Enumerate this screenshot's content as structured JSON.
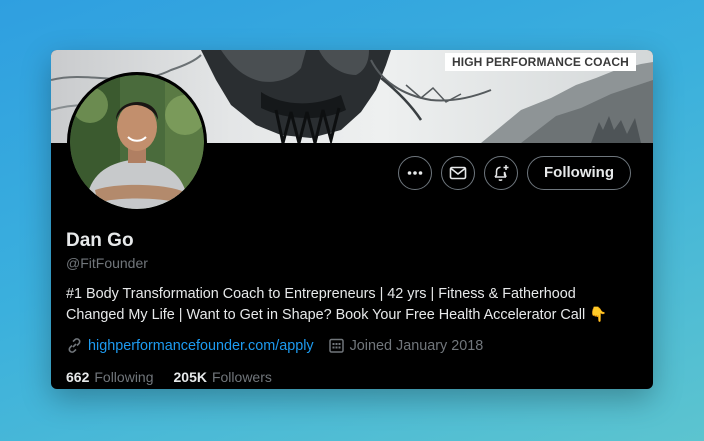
{
  "banner": {
    "badge": "HIGH PERFORMANCE COACH"
  },
  "profile": {
    "name": "Dan Go",
    "handle": "@FitFounder",
    "bio_line1": "#1 Body Transformation Coach to Entrepreneurs | 42 yrs | Fitness & Fatherhood",
    "bio_line2": "Changed My Life | Want to Get in Shape? Book Your Free Health Accelerator Call 👇",
    "website": "highperformancefounder.com/apply",
    "joined": "Joined January 2018"
  },
  "actions": {
    "more_icon": "more-icon",
    "message_icon": "envelope-icon",
    "notify_icon": "bell-plus-icon",
    "follow_label": "Following"
  },
  "stats": {
    "following_count": "662",
    "following_label": "Following",
    "followers_count": "205K",
    "followers_label": "Followers"
  },
  "colors": {
    "background": "#000000",
    "text": "#e7e9ea",
    "muted": "#71767b",
    "link": "#1d9bf0",
    "border": "#6e767d"
  }
}
